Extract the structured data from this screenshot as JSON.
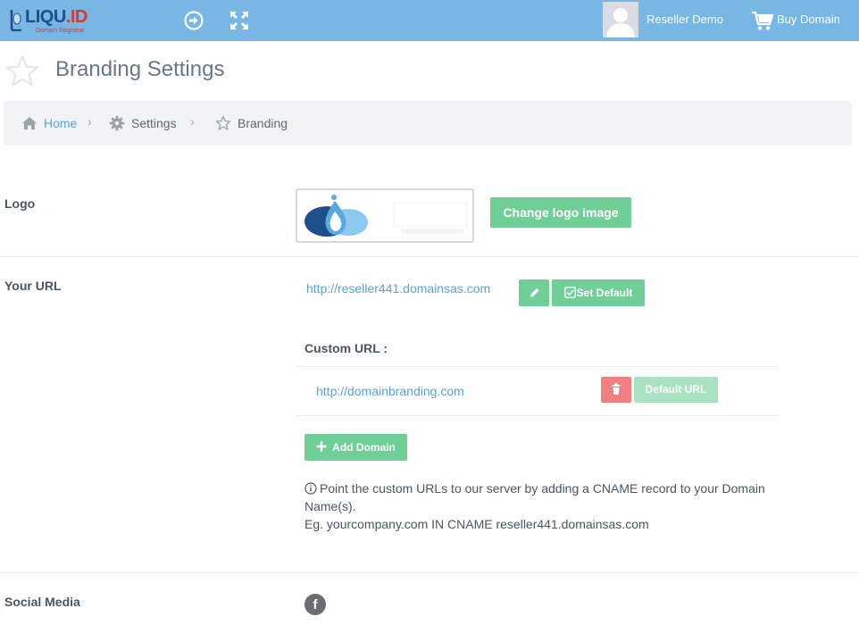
{
  "header": {
    "logo_text": "LIQU",
    "logo_text_accent": ".ID",
    "logo_tagline": "Domain Registrar",
    "user_name": "Reseller Demo",
    "buy_domain": "Buy Domain"
  },
  "page": {
    "title": "Branding Settings"
  },
  "breadcrumb": {
    "items": [
      {
        "label": "Home",
        "icon": "home-icon"
      },
      {
        "label": "Settings",
        "icon": "gear-icon"
      },
      {
        "label": "Branding",
        "icon": "star-icon"
      }
    ],
    "separator": "›"
  },
  "logo_section": {
    "label": "Logo",
    "change_button": "Change logo image"
  },
  "url_section": {
    "label": "Your URL",
    "url": "http://reseller441.domainsas.com",
    "set_default_button": "Set Default",
    "custom_url_heading": "Custom URL :",
    "custom_urls": [
      {
        "url": "http://domainbranding.com",
        "default_button": "Default URL"
      }
    ],
    "add_domain_button": "Add Domain",
    "info_line1": "Point the custom URLs to our server by adding a CNAME record to your Domain Name(s).",
    "info_line2": "Eg. yourcompany.com IN CNAME reseller441.domainsas.com"
  },
  "social_section": {
    "label": "Social Media",
    "facebook_glyph": "f"
  },
  "colors": {
    "topbar": "#78b6e4",
    "accent_green": "#6fcf97",
    "danger_red": "#f08080",
    "link_blue": "#5aa2d8"
  }
}
